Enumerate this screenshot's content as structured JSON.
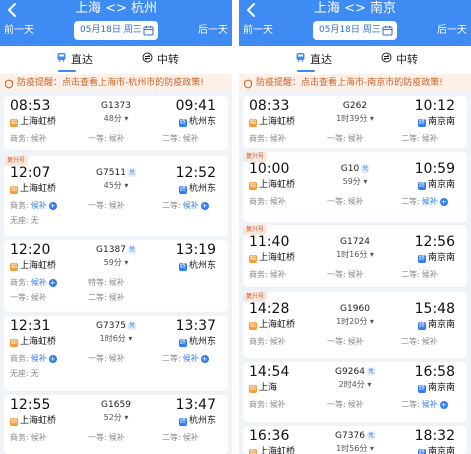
{
  "left": {
    "back": "<",
    "route": "上海 <> 杭州",
    "prev_day": "前一天",
    "next_day": "后一天",
    "date": "05月18日 周三",
    "tabs": [
      "直达",
      "中转"
    ],
    "notice": "防疫提醒：点击查看上海市-杭州市的防疫政策!",
    "trains": [
      {
        "tag": "",
        "dep_time": "08:53",
        "arr_time": "09:41",
        "dep_station": "上海虹桥",
        "arr_station": "杭州东",
        "train_no": "G1373",
        "fuxing": false,
        "duration": "48分",
        "seats": [
          {
            "label": "商务:",
            "value": "候补"
          },
          {
            "label": "一等:",
            "value": "候补"
          },
          {
            "label": "二等:",
            "value": "候补"
          }
        ]
      },
      {
        "tag": "复兴号",
        "dep_time": "12:07",
        "arr_time": "12:52",
        "dep_station": "上海虹桥",
        "arr_station": "杭州东",
        "train_no": "G7511",
        "fuxing": true,
        "duration": "45分",
        "seats": [
          {
            "label": "商务:",
            "value": "候补"
          },
          {
            "label": "一等:",
            "value": "候补"
          },
          {
            "label": "二等:",
            "value": "候补"
          },
          {
            "label": "无座:",
            "value": "无"
          }
        ]
      },
      {
        "tag": "",
        "dep_time": "12:20",
        "arr_time": "13:19",
        "dep_station": "上海虹桥",
        "arr_station": "杭州东",
        "train_no": "G1387",
        "fuxing": true,
        "duration": "59分",
        "seats": [
          {
            "label": "商务:",
            "value": "候补"
          },
          {
            "label": "特等:",
            "value": "候补"
          },
          {
            "label": "一等:",
            "value": "候补"
          },
          {
            "label": "二等:",
            "value": "候补"
          }
        ]
      },
      {
        "tag": "",
        "dep_time": "12:31",
        "arr_time": "13:37",
        "dep_station": "上海虹桥",
        "arr_station": "杭州东",
        "train_no": "G7375",
        "fuxing": true,
        "duration": "1时6分",
        "seats": [
          {
            "label": "商务:",
            "value": "候补"
          },
          {
            "label": "一等:",
            "value": "候补"
          },
          {
            "label": "二等:",
            "value": "候补"
          },
          {
            "label": "无座:",
            "value": "无"
          }
        ]
      },
      {
        "tag": "",
        "dep_time": "12:55",
        "arr_time": "13:47",
        "dep_station": "上海虹桥",
        "arr_station": "杭州东",
        "train_no": "G1659",
        "fuxing": false,
        "duration": "52分",
        "seats": [
          {
            "label": "商务:",
            "value": "候补"
          },
          {
            "label": "一等:",
            "value": "候补"
          },
          {
            "label": "二等:",
            "value": "候补"
          }
        ]
      }
    ]
  },
  "right": {
    "back": "<",
    "route": "上海 <> 南京",
    "prev_day": "前一天",
    "next_day": "后一天",
    "date": "05月18日 周三",
    "tabs": [
      "直达",
      "中转"
    ],
    "notice": "防疫提醒：点击查看上海市-南京市的防疫政策!",
    "trains": [
      {
        "tag": "",
        "dep_time": "08:33",
        "arr_time": "10:12",
        "dep_station": "上海虹桥",
        "arr_station": "南京南",
        "train_no": "G262",
        "fuxing": false,
        "duration": "1时39分",
        "seats": [
          {
            "label": "商务:",
            "value": "候补"
          },
          {
            "label": "一等:",
            "value": "候补"
          },
          {
            "label": "二等:",
            "value": "候补"
          }
        ]
      },
      {
        "tag": "复兴号",
        "dep_time": "10:00",
        "arr_time": "10:59",
        "dep_station": "上海虹桥",
        "arr_station": "南京南",
        "train_no": "G10",
        "fuxing": true,
        "duration": "59分",
        "seats": [
          {
            "label": "商务:",
            "value": "候补"
          },
          {
            "label": "一等:",
            "value": "候补"
          },
          {
            "label": "二等:",
            "value": "候补"
          }
        ]
      },
      {
        "tag": "复兴号",
        "dep_time": "11:40",
        "arr_time": "12:56",
        "dep_station": "上海虹桥",
        "arr_station": "南京南",
        "train_no": "G1724",
        "fuxing": false,
        "duration": "1时16分",
        "seats": [
          {
            "label": "商务:",
            "value": "候补"
          },
          {
            "label": "一等:",
            "value": "候补"
          },
          {
            "label": "二等:",
            "value": "候补"
          }
        ]
      },
      {
        "tag": "复兴号",
        "dep_time": "14:28",
        "arr_time": "15:48",
        "dep_station": "上海虹桥",
        "arr_station": "南京南",
        "train_no": "G1960",
        "fuxing": false,
        "duration": "1时20分",
        "seats": [
          {
            "label": "商务:",
            "value": "候补"
          },
          {
            "label": "一等:",
            "value": "候补"
          },
          {
            "label": "二等:",
            "value": "候补"
          }
        ]
      },
      {
        "tag": "",
        "dep_time": "14:54",
        "arr_time": "16:58",
        "dep_station": "上海",
        "arr_station": "南京南",
        "train_no": "G9264",
        "fuxing": true,
        "duration": "2时4分",
        "seats": [
          {
            "label": "商务:",
            "value": "候补"
          },
          {
            "label": "一等:",
            "value": "候补"
          },
          {
            "label": "二等:",
            "value": "候补"
          }
        ]
      },
      {
        "tag": "",
        "dep_time": "16:36",
        "arr_time": "18:32",
        "dep_station": "上海虹桥",
        "arr_station": "南京南",
        "train_no": "G7376",
        "fuxing": true,
        "duration": "1时56分",
        "seats": []
      }
    ]
  },
  "colors": {
    "header": "#3f8bf4",
    "accent": "#2f7cf1",
    "notice_text": "#d0612d",
    "depart_badge": "#f59a3a",
    "arrive_badge": "#2f7cf1"
  },
  "icons": {
    "depart": "始",
    "arrive": "终",
    "fuxing_mark": "兑",
    "plus": "+"
  }
}
